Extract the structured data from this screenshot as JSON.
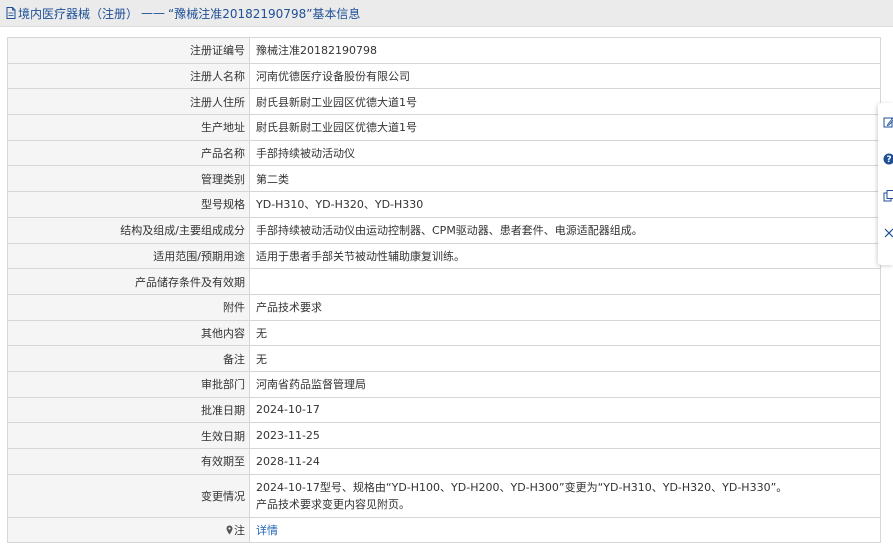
{
  "header": {
    "breadcrumb": "境内医疗器械（注册）",
    "separator": "——",
    "record_title": "“豫械注准20182190798”基本信息"
  },
  "rows": [
    {
      "label": "注册证编号",
      "value": "豫械注准20182190798"
    },
    {
      "label": "注册人名称",
      "value": "河南优德医疗设备股份有限公司"
    },
    {
      "label": "注册人住所",
      "value": "尉氏县新尉工业园区优德大道1号"
    },
    {
      "label": "生产地址",
      "value": "尉氏县新尉工业园区优德大道1号"
    },
    {
      "label": "产品名称",
      "value": "手部持续被动活动仪"
    },
    {
      "label": "管理类别",
      "value": "第二类"
    },
    {
      "label": "型号规格",
      "value": "YD-H310、YD-H320、YD-H330"
    },
    {
      "label": "结构及组成/主要组成成分",
      "value": "手部持续被动活动仪由运动控制器、CPM驱动器、患者套件、电源适配器组成。"
    },
    {
      "label": "适用范围/预期用途",
      "value": "适用于患者手部关节被动性辅助康复训练。"
    },
    {
      "label": "产品储存条件及有效期",
      "value": ""
    },
    {
      "label": "附件",
      "value": "产品技术要求"
    },
    {
      "label": "其他内容",
      "value": "无"
    },
    {
      "label": "备注",
      "value": "无"
    },
    {
      "label": "审批部门",
      "value": "河南省药品监督管理局"
    },
    {
      "label": "批准日期",
      "value": "2024-10-17"
    },
    {
      "label": "生效日期",
      "value": "2023-11-25"
    },
    {
      "label": "有效期至",
      "value": "2028-11-24"
    },
    {
      "label": "变更情况",
      "value_line1": "2024-10-17型号、规格由“YD-H100、YD-H200、YD-H300”变更为“YD-H310、YD-H320、YD-H330”。",
      "value_line2": "产品技术要求变更内容见附页。"
    },
    {
      "label": "注",
      "value": "详情"
    }
  ],
  "side_panel": {
    "icons": [
      "edit-icon",
      "help-icon",
      "copy-icon",
      "close-icon"
    ]
  },
  "colors": {
    "title_text": "#1e4f97",
    "link": "#1e64b4",
    "label_bg": "#f5f5f5",
    "border": "#d6d6d6"
  }
}
